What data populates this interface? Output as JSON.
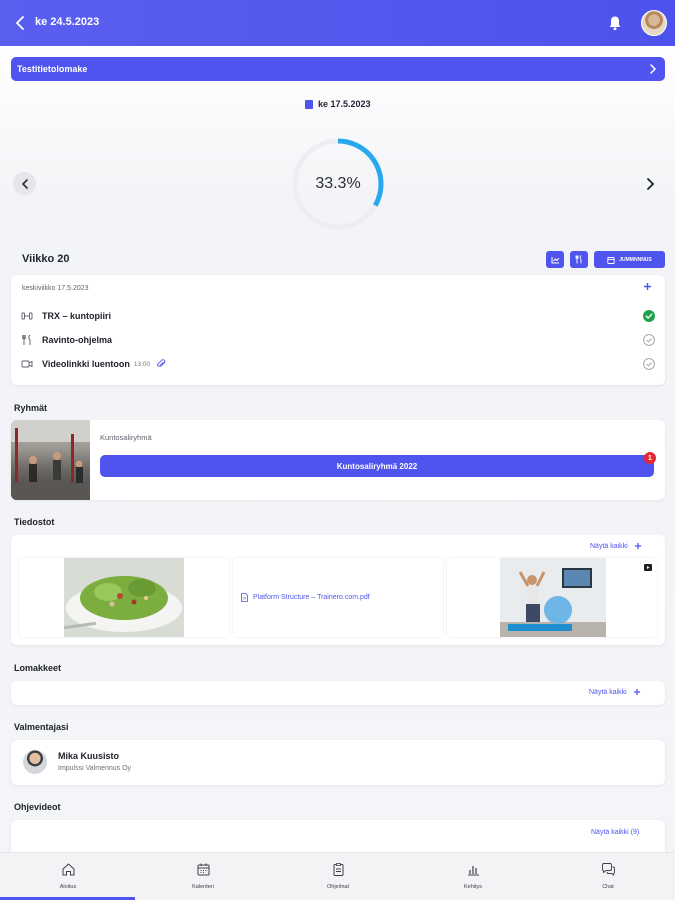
{
  "header": {
    "title": "ke 24.5.2023"
  },
  "form_banner": {
    "label": "Testitietolomake"
  },
  "progress": {
    "date": "ke 17.5.2023",
    "value_text": "33.3%",
    "value": 0.333
  },
  "week": {
    "title": "Viikko 20",
    "button_label": "JUMMNNNUS"
  },
  "day": {
    "header": "keskiviikko 17.5.2023",
    "tasks": [
      {
        "label": "TRX – kuntopiiri",
        "time": "",
        "status": "done"
      },
      {
        "label": "Ravinto-ohjelma",
        "time": "",
        "status": "pending"
      },
      {
        "label": "Videolinkki luentoon",
        "time": "13:00",
        "status": "pending"
      }
    ]
  },
  "groups": {
    "title": "Ryhmät",
    "group_name": "Kuntosaliryhmä",
    "button_label": "Kuntosaliryhmä 2022",
    "badge": "1"
  },
  "files": {
    "title": "Tiedostot",
    "show_all": "Näytä kaikki",
    "pdf_name": "Platform Structure – Trainero.com.pdf"
  },
  "forms": {
    "title": "Lomakkeet",
    "show_all": "Näytä kaikki"
  },
  "coach": {
    "title": "Valmentajasi",
    "name": "Mika Kuusisto",
    "company": "Impulssi Valmennus Oy"
  },
  "videos": {
    "title": "Ohjevideot",
    "show_all": "Näytä kaikki (9)"
  },
  "nav": {
    "items": [
      {
        "label": "Aloitus"
      },
      {
        "label": "Kalenteri"
      },
      {
        "label": "Ohjelmat"
      },
      {
        "label": "Kehitys"
      },
      {
        "label": "Chat"
      }
    ]
  },
  "colors": {
    "accent": "#4f54ee",
    "done": "#1fa04a",
    "badge": "#e8262f",
    "progress": "#29a8f0"
  }
}
